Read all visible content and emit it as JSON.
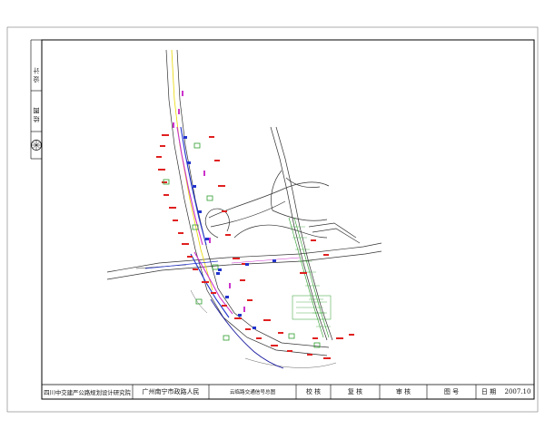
{
  "title_block": {
    "org": "四川中交建严公路规划设计研究院",
    "project": "广州南宁市政路人民",
    "drawing": "云临路交通信号总图",
    "check_label": "校 核",
    "review_label": "复 核",
    "approve_label": "审 核",
    "number_label": "图 号",
    "date_label": "日 期",
    "date_value": "2007.10"
  },
  "side_block": {
    "design_label": "设 计",
    "drawn_label": "绘 图"
  },
  "colors": {
    "road_line": "#333333",
    "green_belt": "#2e9e2e",
    "signal_red": "#e02020",
    "marking_blue": "#2233cc",
    "magenta": "#cc33cc",
    "river_blue": "#1a1aa0",
    "center_yellow": "#e8d800"
  }
}
